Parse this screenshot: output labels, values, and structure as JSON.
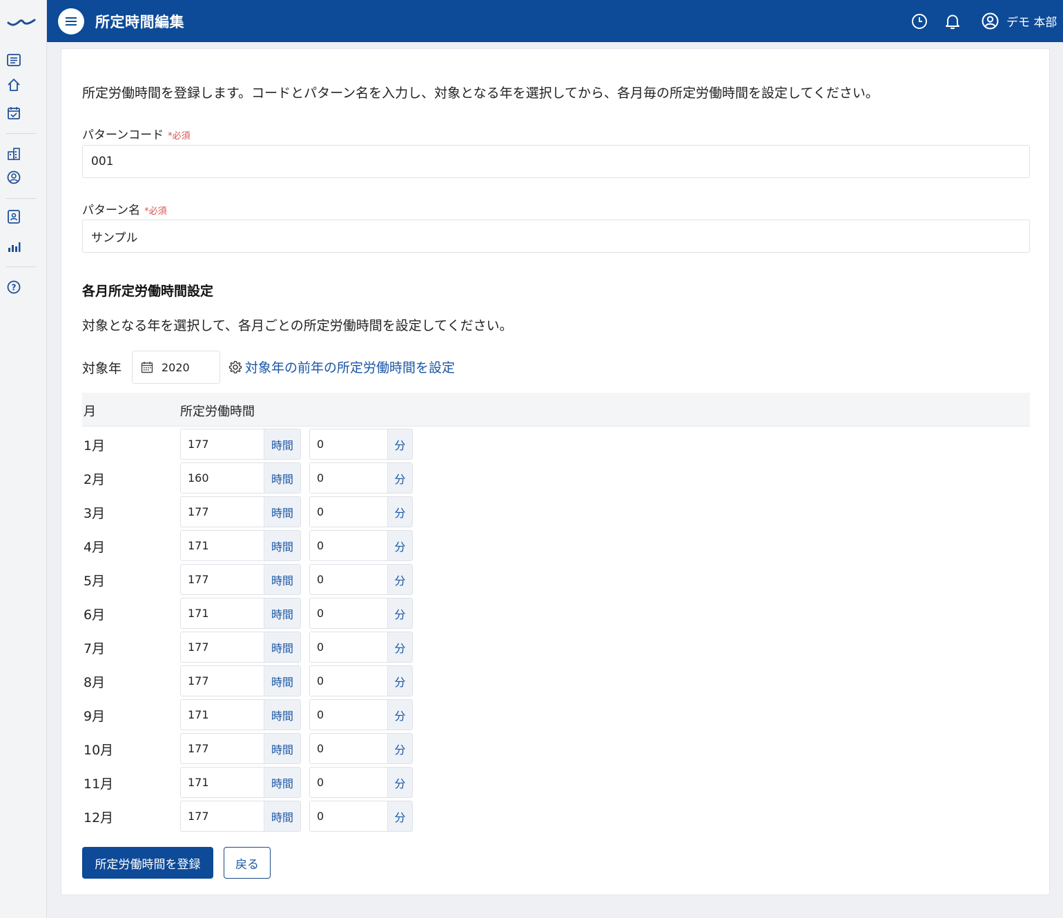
{
  "app": {
    "page_title": "所定時間編集",
    "user_name": "デモ 本部",
    "accent_color": "#0d4a97"
  },
  "sidebar": {
    "icons": [
      "list-icon",
      "home-icon",
      "calendar-check-icon",
      "building-icon",
      "user-circle-icon",
      "id-badge-icon",
      "bar-chart-icon",
      "help-icon"
    ]
  },
  "header": {
    "icons": [
      "menu-icon",
      "clock-icon",
      "bell-icon",
      "user-icon"
    ]
  },
  "form": {
    "intro": "所定労働時間を登録します。コードとパターン名を入力し、対象となる年を選択してから、各月毎の所定労働時間を設定してください。",
    "required_mark": "*必須",
    "code_label": "パターンコード",
    "code_value": "001",
    "name_label": "パターン名",
    "name_value": "サンプル"
  },
  "monthly": {
    "section_title": "各月所定労働時間設定",
    "description": "対象となる年を選択して、各月ごとの所定労働時間を設定してください。",
    "year_label": "対象年",
    "year_value": "2020",
    "prev_year_link": "対象年の前年の所定労働時間を設定",
    "col_month": "月",
    "col_hours": "所定労働時間",
    "hour_unit": "時間",
    "minute_unit": "分",
    "rows": [
      {
        "month": "1月",
        "hours": "177",
        "minutes": "0"
      },
      {
        "month": "2月",
        "hours": "160",
        "minutes": "0"
      },
      {
        "month": "3月",
        "hours": "177",
        "minutes": "0"
      },
      {
        "month": "4月",
        "hours": "171",
        "minutes": "0"
      },
      {
        "month": "5月",
        "hours": "177",
        "minutes": "0"
      },
      {
        "month": "6月",
        "hours": "171",
        "minutes": "0"
      },
      {
        "month": "7月",
        "hours": "177",
        "minutes": "0"
      },
      {
        "month": "8月",
        "hours": "177",
        "minutes": "0"
      },
      {
        "month": "9月",
        "hours": "171",
        "minutes": "0"
      },
      {
        "month": "10月",
        "hours": "177",
        "minutes": "0"
      },
      {
        "month": "11月",
        "hours": "171",
        "minutes": "0"
      },
      {
        "month": "12月",
        "hours": "177",
        "minutes": "0"
      }
    ]
  },
  "actions": {
    "submit_label": "所定労働時間を登録",
    "back_label": "戻る"
  }
}
